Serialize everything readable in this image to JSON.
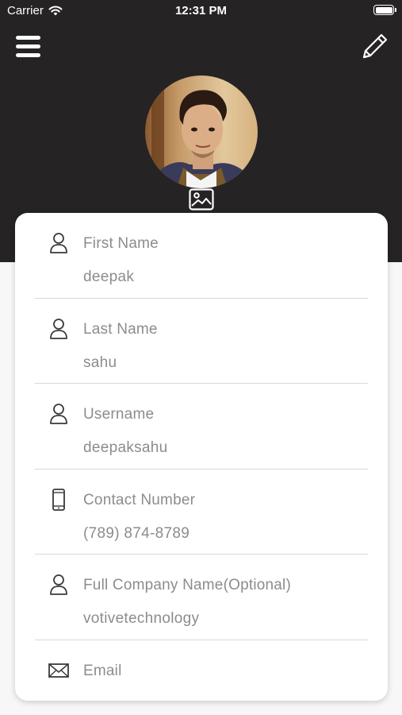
{
  "status_bar": {
    "carrier": "Carrier",
    "time": "12:31 PM",
    "icons": [
      "wifi-icon",
      "battery-icon"
    ]
  },
  "header": {
    "background_color": "#262324",
    "menu_icon": "hamburger-menu-icon",
    "edit_icon": "pencil-icon",
    "avatar_icon": "profile-photo",
    "change_photo_icon": "image-icon"
  },
  "profile": {
    "fields": [
      {
        "icon": "user-icon",
        "label": "First Name",
        "value": "deepak"
      },
      {
        "icon": "user-icon",
        "label": "Last Name",
        "value": "sahu"
      },
      {
        "icon": "user-icon",
        "label": "Username",
        "value": "deepaksahu"
      },
      {
        "icon": "phone-icon",
        "label": "Contact Number",
        "value": "(789) 874-8789"
      },
      {
        "icon": "user-icon",
        "label": "Full Company Name(Optional)",
        "value": "votivetechnology"
      },
      {
        "icon": "mail-icon",
        "label": "Email",
        "value": ""
      }
    ]
  },
  "colors": {
    "text_gray": "#8c8c8c",
    "card_background": "#ffffff",
    "page_background": "#f7f7f7"
  }
}
